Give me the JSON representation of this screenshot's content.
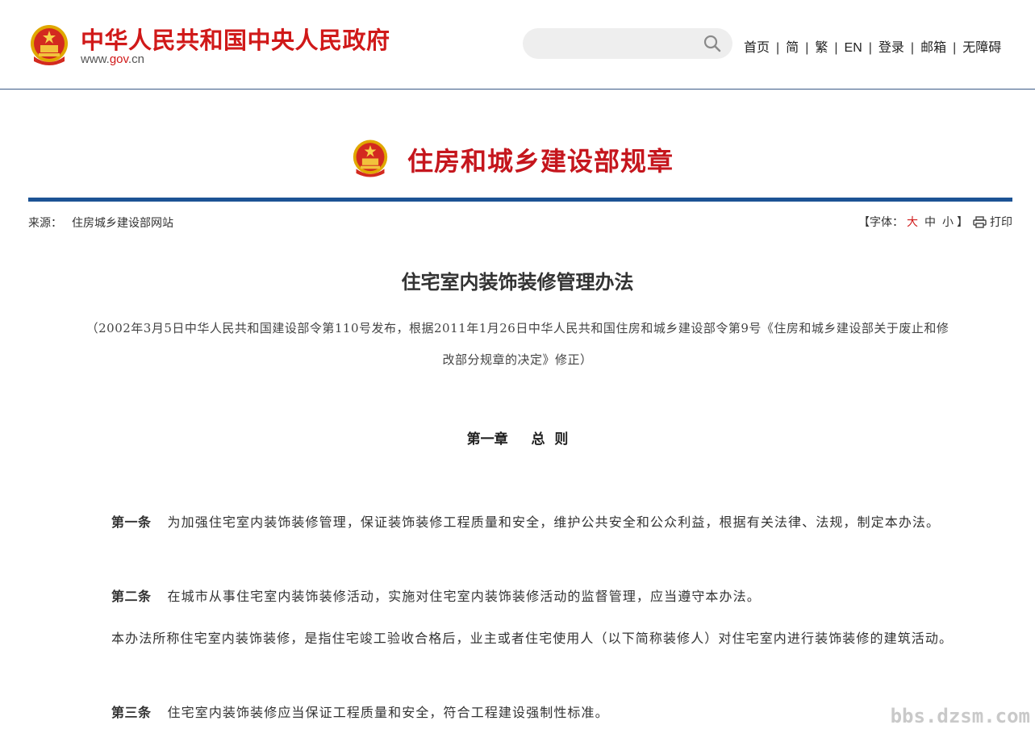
{
  "header": {
    "site_title": "中华人民共和国中央人民政府",
    "site_url_prefix": "www.",
    "site_url_domain": "gov",
    "site_url_suffix": ".cn",
    "search_placeholder": "",
    "nav": [
      "首页",
      "简",
      "繁",
      "EN",
      "登录",
      "邮箱",
      "无障碍"
    ]
  },
  "section": {
    "title": "住房和城乡建设部规章"
  },
  "meta": {
    "source_label": "来源：",
    "source_value": "住房城乡建设部网站",
    "font_label_open": "【字体：",
    "font_large": "大",
    "font_medium": "中",
    "font_small": "小",
    "font_label_close": "】",
    "print_label": "打印"
  },
  "article": {
    "title": "住宅室内装饰装修管理办法",
    "note": "（2002年3月5日中华人民共和国建设部令第110号发布，根据2011年1月26日中华人民共和国住房和城乡建设部令第9号《住房和城乡建设部关于废止和修改部分规章的决定》修正）",
    "chapter": "第一章　 总 则",
    "paragraphs": [
      {
        "label": "第一条",
        "text": "为加强住宅室内装饰装修管理，保证装饰装修工程质量和安全，维护公共安全和公众利益，根据有关法律、法规，制定本办法。"
      },
      {
        "label": "第二条",
        "text": "在城市从事住宅室内装饰装修活动，实施对住宅室内装饰装修活动的监督管理，应当遵守本办法。"
      },
      {
        "label": "",
        "text": "本办法所称住宅室内装饰装修，是指住宅竣工验收合格后，业主或者住宅使用人（以下简称装修人）对住宅室内进行装饰装修的建筑活动。"
      },
      {
        "label": "第三条",
        "text": "住宅室内装饰装修应当保证工程质量和安全，符合工程建设强制性标准。"
      }
    ]
  },
  "watermark": "bbs.dzsm.com",
  "colors": {
    "brand_red": "#d01919",
    "accent_blue": "#1c5394"
  }
}
